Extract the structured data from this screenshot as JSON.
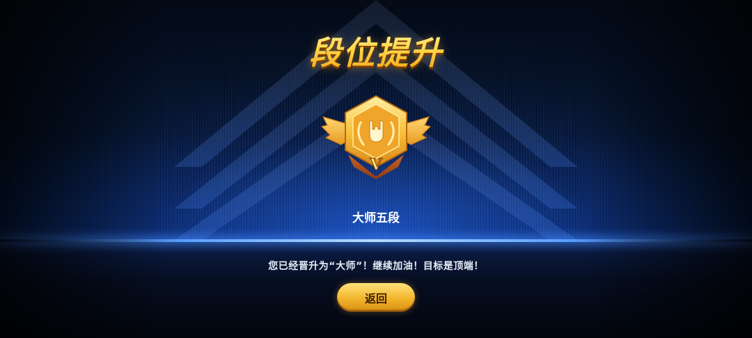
{
  "screen": {
    "title": "段位提升",
    "rank": {
      "name": "大师五段",
      "badge_numeral": "V",
      "badge_icon": "rock-hand-laurel-icon",
      "badge_color": "#f5b630"
    },
    "message": "您已经晋升为“大师”！继续加油！目标是顶端！",
    "back_button": {
      "label": "返回"
    }
  },
  "colors": {
    "title_gold": "#ffd24a",
    "accent_blue": "#2f6dff",
    "button_gold": "#f2b52c"
  }
}
